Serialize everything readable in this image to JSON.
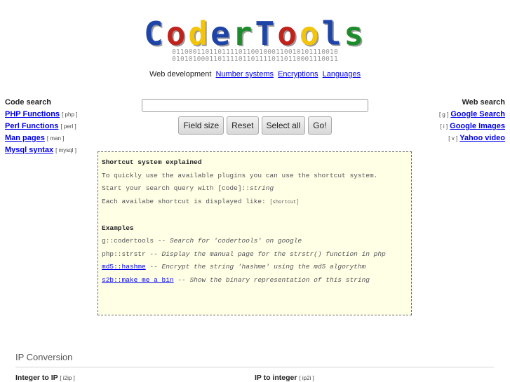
{
  "header": {
    "logo_letters": [
      {
        "ch": "C",
        "color": "#1f44a8"
      },
      {
        "ch": "o",
        "color": "#c0221c"
      },
      {
        "ch": "d",
        "color": "#f2c40a"
      },
      {
        "ch": "e",
        "color": "#1f44a8"
      },
      {
        "ch": "r",
        "color": "#1c8c2a"
      },
      {
        "ch": "T",
        "color": "#1f44a8"
      },
      {
        "ch": "o",
        "color": "#c0221c"
      },
      {
        "ch": "o",
        "color": "#f2c40a"
      },
      {
        "ch": "l",
        "color": "#1f44a8"
      },
      {
        "ch": "s",
        "color": "#1c8c2a"
      }
    ],
    "binary_line1": "0110001101101111011001000110010101110010",
    "binary_line2": "0101010001101111011011110110110001110011",
    "nav_current": "Web development",
    "nav_links": [
      "Number systems",
      "Encryptions",
      "Languages"
    ]
  },
  "left": {
    "title": "Code search",
    "items": [
      {
        "label": "PHP Functions",
        "code": "[ php ]"
      },
      {
        "label": "Perl Functions",
        "code": "[ perl ]"
      },
      {
        "label": "Man pages",
        "code": "[ man ]"
      },
      {
        "label": "Mysql syntax",
        "code": "[ mysql ]"
      }
    ]
  },
  "right": {
    "title": "Web search",
    "items": [
      {
        "code": "[ g ]",
        "label": "Google Search"
      },
      {
        "code": "[ i ]",
        "label": "Google Images"
      },
      {
        "code": "[ v ]",
        "label": "Yahoo video"
      }
    ]
  },
  "search": {
    "value": "",
    "buttons": [
      "Field size",
      "Reset",
      "Select all",
      "Go!"
    ]
  },
  "shortcut_box": {
    "title": "Shortcut system explained",
    "line1": "To quickly use the available plugins you can use the shortcut system.",
    "line2_prefix": "Start your search query with [code]::",
    "line2_italic": "string",
    "line3_prefix": "Each availabe shortcut is displayed like: ",
    "line3_small": "[shortcut]",
    "examples_title": "Examples",
    "examples": [
      {
        "code": "g::codertools",
        "sep": " -- ",
        "desc": "Search for 'codertools' on google",
        "link": false
      },
      {
        "code": "php::strstr",
        "sep": " -- ",
        "desc": "Display the manual page for the strstr() function in php",
        "link": false
      },
      {
        "code": "md5::hashme",
        "sep": " -- ",
        "desc": "Encrypt the string 'hashme' using the md5 algorythm",
        "link": true
      },
      {
        "code": "s2b::make me a bin",
        "sep": " -- ",
        "desc": "Show the binary representation of this string",
        "link": true
      }
    ]
  },
  "ip_section": {
    "title": "IP Conversion",
    "left_label": "Integer to IP",
    "left_code": "[ i2ip ]",
    "right_label": "IP to integer",
    "right_code": "[ ip2i ]"
  }
}
